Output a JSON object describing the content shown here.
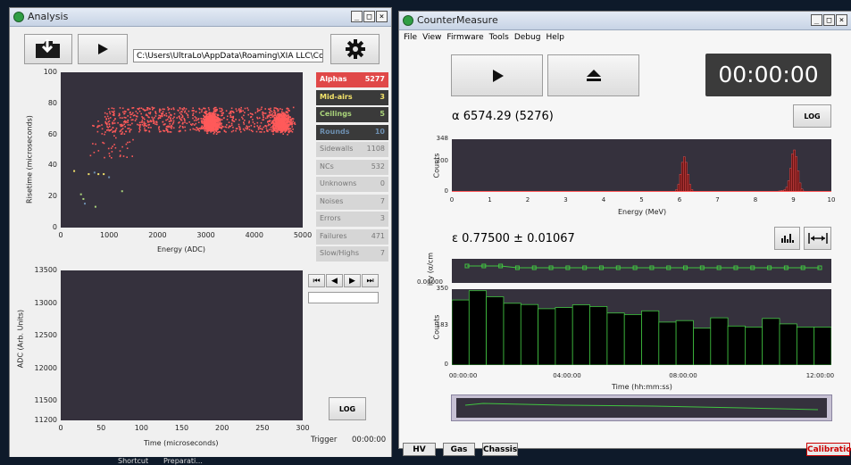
{
  "taskbar": {
    "item1": "Shortcut",
    "item2": "Preparati..."
  },
  "analysis": {
    "title": "Analysis",
    "path_value": "C:\\Users\\UltraLo\\AppData\\Roaming\\XIA LLC\\Counte",
    "log_label": "LOG",
    "trigger_label": "Trigger",
    "trigger_time": "00:00:00",
    "counters": [
      {
        "label": "Alphas",
        "value": "5277",
        "bg": "#e04848",
        "fg": "#ffffff"
      },
      {
        "label": "Mid-airs",
        "value": "3",
        "bg": "#3a3a3a",
        "fg": "#f4e36a"
      },
      {
        "label": "Ceilings",
        "value": "5",
        "bg": "#3a3a3a",
        "fg": "#a9d37a"
      },
      {
        "label": "Rounds",
        "value": "10",
        "bg": "#3a3a3a",
        "fg": "#6d8fb0"
      },
      {
        "label": "Sidewalls",
        "value": "1108",
        "bg": "#d6d6d6",
        "fg": "#777777"
      },
      {
        "label": "NCs",
        "value": "532",
        "bg": "#d6d6d6",
        "fg": "#777777"
      },
      {
        "label": "Unknowns",
        "value": "0",
        "bg": "#d6d6d6",
        "fg": "#777777"
      },
      {
        "label": "Noises",
        "value": "7",
        "bg": "#d6d6d6",
        "fg": "#777777"
      },
      {
        "label": "Errors",
        "value": "3",
        "bg": "#d6d6d6",
        "fg": "#777777"
      },
      {
        "label": "Failures",
        "value": "471",
        "bg": "#d6d6d6",
        "fg": "#777777"
      },
      {
        "label": "Slow/Highs",
        "value": "7",
        "bg": "#d6d6d6",
        "fg": "#777777"
      }
    ],
    "nav_buttons": [
      "⏮",
      "◀",
      "▶",
      "⏭"
    ],
    "scatter_plot": {
      "xlabel": "Energy (ADC)",
      "ylabel": "Risetime (microseconds)",
      "xticks": [
        "0",
        "1000",
        "2000",
        "3000",
        "4000",
        "5000"
      ],
      "yticks": [
        "0",
        "20",
        "40",
        "60",
        "80",
        "100"
      ],
      "xlim": [
        0,
        5000
      ],
      "ylim": [
        0,
        100
      ]
    },
    "trace_plot": {
      "xlabel": "Time (microseconds)",
      "ylabel": "ADC (Arb. Units)",
      "xticks": [
        "0",
        "50",
        "100",
        "150",
        "200",
        "250",
        "300"
      ],
      "yticks": [
        "11200",
        "11500",
        "12000",
        "12500",
        "13000",
        "13500"
      ]
    }
  },
  "countermeasure": {
    "title": "CounterMeasure",
    "menu": [
      "File",
      "View",
      "Firmware",
      "Tools",
      "Debug",
      "Help"
    ],
    "timer": "00:00:00",
    "alpha_readout": "α  6574.29 (5276)",
    "log_label": "LOG",
    "epsilon_readout": "ε  0.77500 ± 0.01067",
    "spectrum": {
      "xlabel": "Energy (MeV)",
      "ylabel": "Counts",
      "xticks": [
        "0",
        "1",
        "2",
        "3",
        "4",
        "5",
        "6",
        "7",
        "8",
        "9",
        "10"
      ],
      "yticks": [
        "0",
        "200",
        "348"
      ]
    },
    "efficiency": {
      "ylabel": "icy (α/cm",
      "ytick": "0.00000"
    },
    "rate": {
      "xlabel": "Time (hh:mm:ss)",
      "ylabel": "Counts",
      "xticks": [
        "00:00:00",
        "04:00:00",
        "08:00:00",
        "12:00:00"
      ],
      "yticks": [
        "0",
        "183",
        "350"
      ]
    },
    "tabs": [
      "HV",
      "Gas",
      "Chassis"
    ],
    "calibration_tab": "Calibration"
  },
  "colors": {
    "alpha_red": "#ff5a5a",
    "plot_bg": "#35313d",
    "green": "#41c441",
    "timer_bg": "#3b3b3b"
  },
  "chart_data": [
    {
      "type": "scatter",
      "xlabel": "Energy (ADC)",
      "ylabel": "Risetime (microseconds)",
      "xlim": [
        0,
        5000
      ],
      "ylim": [
        0,
        100
      ],
      "series": [
        {
          "name": "Alphas",
          "values": "dense clusters near x≈3100,y≈68 and x≈4550,y≈68 plus band x 800–4800, y 55–80"
        },
        {
          "name": "Mid-airs",
          "points": [
            [
              260,
              37
            ],
            [
              560,
              35
            ],
            [
              760,
              35
            ],
            [
              870,
              35
            ]
          ]
        },
        {
          "name": "Ceilings",
          "points": [
            [
              400,
              22
            ],
            [
              450,
              19
            ],
            [
              700,
              14
            ],
            [
              1250,
              24
            ]
          ]
        },
        {
          "name": "Rounds",
          "points": [
            [
              480,
              16
            ],
            [
              680,
              36
            ],
            [
              980,
              33
            ]
          ]
        }
      ]
    },
    {
      "type": "bar",
      "xlabel": "Energy (MeV)",
      "ylabel": "Counts",
      "xlim": [
        0,
        10
      ],
      "ylim": [
        0,
        348
      ],
      "peaks": [
        {
          "x": 6.1,
          "y": 230
        },
        {
          "x": 9.0,
          "y": 275
        }
      ]
    },
    {
      "type": "line",
      "ytick": "0.00000",
      "points_count": 22
    },
    {
      "type": "bar",
      "xlabel": "Time (hh:mm:ss)",
      "ylabel": "Counts",
      "ylim": [
        0,
        350
      ],
      "values": [
        300,
        343,
        315,
        285,
        279,
        260,
        265,
        278,
        270,
        240,
        233,
        250,
        198,
        205,
        170,
        218,
        180,
        175,
        215,
        190,
        175,
        175
      ]
    }
  ]
}
